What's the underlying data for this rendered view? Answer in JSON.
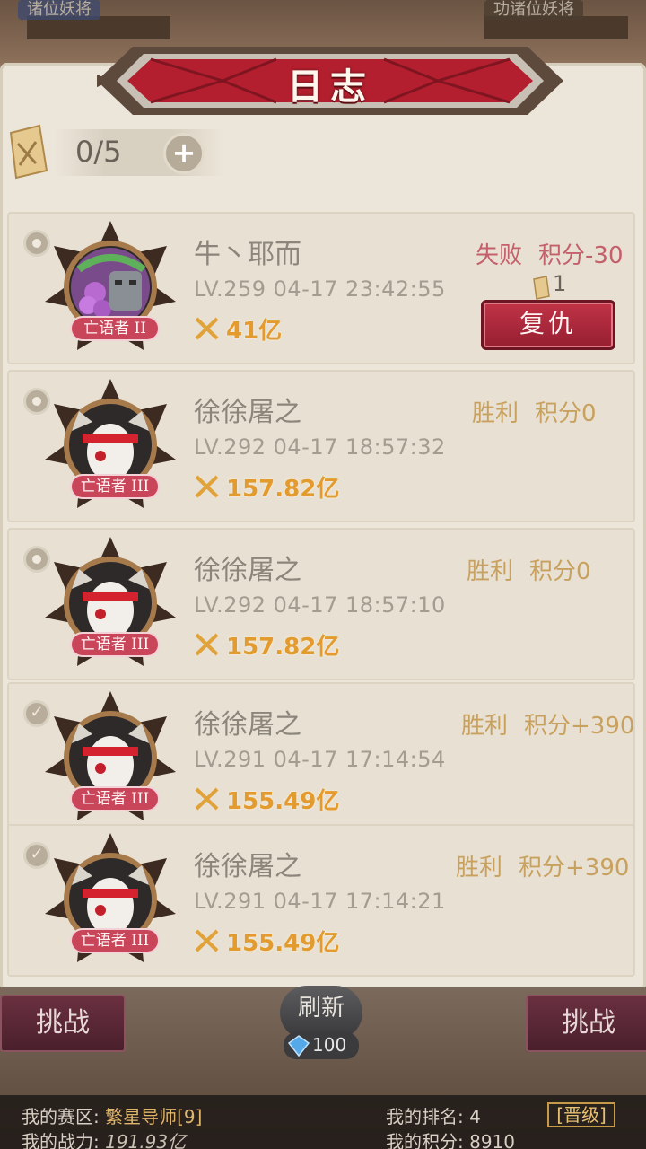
{
  "top_bar": {
    "left_label": "诸位妖将",
    "right_label": "功诸位妖将"
  },
  "dialog": {
    "title": "日志",
    "tickets": "0/5",
    "add_label": "+"
  },
  "entries": [
    {
      "name": "牛丶耶而",
      "meta": "LV.259  04-17 23:42:55",
      "power": "41亿",
      "result": "失败",
      "score": "积分-30",
      "reward": "1",
      "rank_tag": "亡语者 II",
      "action": "复仇",
      "status": "lose",
      "avatar": "golem"
    },
    {
      "name": "徐徐屠之",
      "meta": "LV.292  04-17 18:57:32",
      "power": "157.82亿",
      "result": "胜利",
      "score": "积分0",
      "rank_tag": "亡语者 III",
      "status": "win",
      "avatar": "masked"
    },
    {
      "name": "徐徐屠之",
      "meta": "LV.292  04-17 18:57:10",
      "power": "157.82亿",
      "result": "胜利",
      "score": "积分0",
      "rank_tag": "亡语者 III",
      "status": "win",
      "avatar": "masked"
    },
    {
      "name": "徐徐屠之",
      "meta": "LV.291  04-17 17:14:54",
      "power": "155.49亿",
      "result": "胜利",
      "score": "积分+390",
      "rank_tag": "亡语者 III",
      "status": "win",
      "avatar": "masked"
    },
    {
      "name": "徐徐屠之",
      "meta": "LV.291  04-17 17:14:21",
      "power": "155.49亿",
      "result": "胜利",
      "score": "积分+390",
      "rank_tag": "亡语者 III",
      "status": "win",
      "avatar": "masked"
    }
  ],
  "bottom": {
    "challenge_left": "挑战",
    "challenge_right": "挑战",
    "refresh": "刷新",
    "refresh_cost": "100",
    "zone_label": "我的赛区:",
    "zone_value": "繁星导师[9]",
    "power_label": "我的战力:",
    "power_value": "191.93亿",
    "rank_label": "我的排名:",
    "rank_value": "4",
    "rank_button": "[晋级]",
    "score_label": "我的积分:",
    "score_value": "8910"
  },
  "colors": {
    "win": "#c9a15e",
    "lose": "#c4606b",
    "power": "#e39b2f",
    "banner": "#b41f2f"
  }
}
